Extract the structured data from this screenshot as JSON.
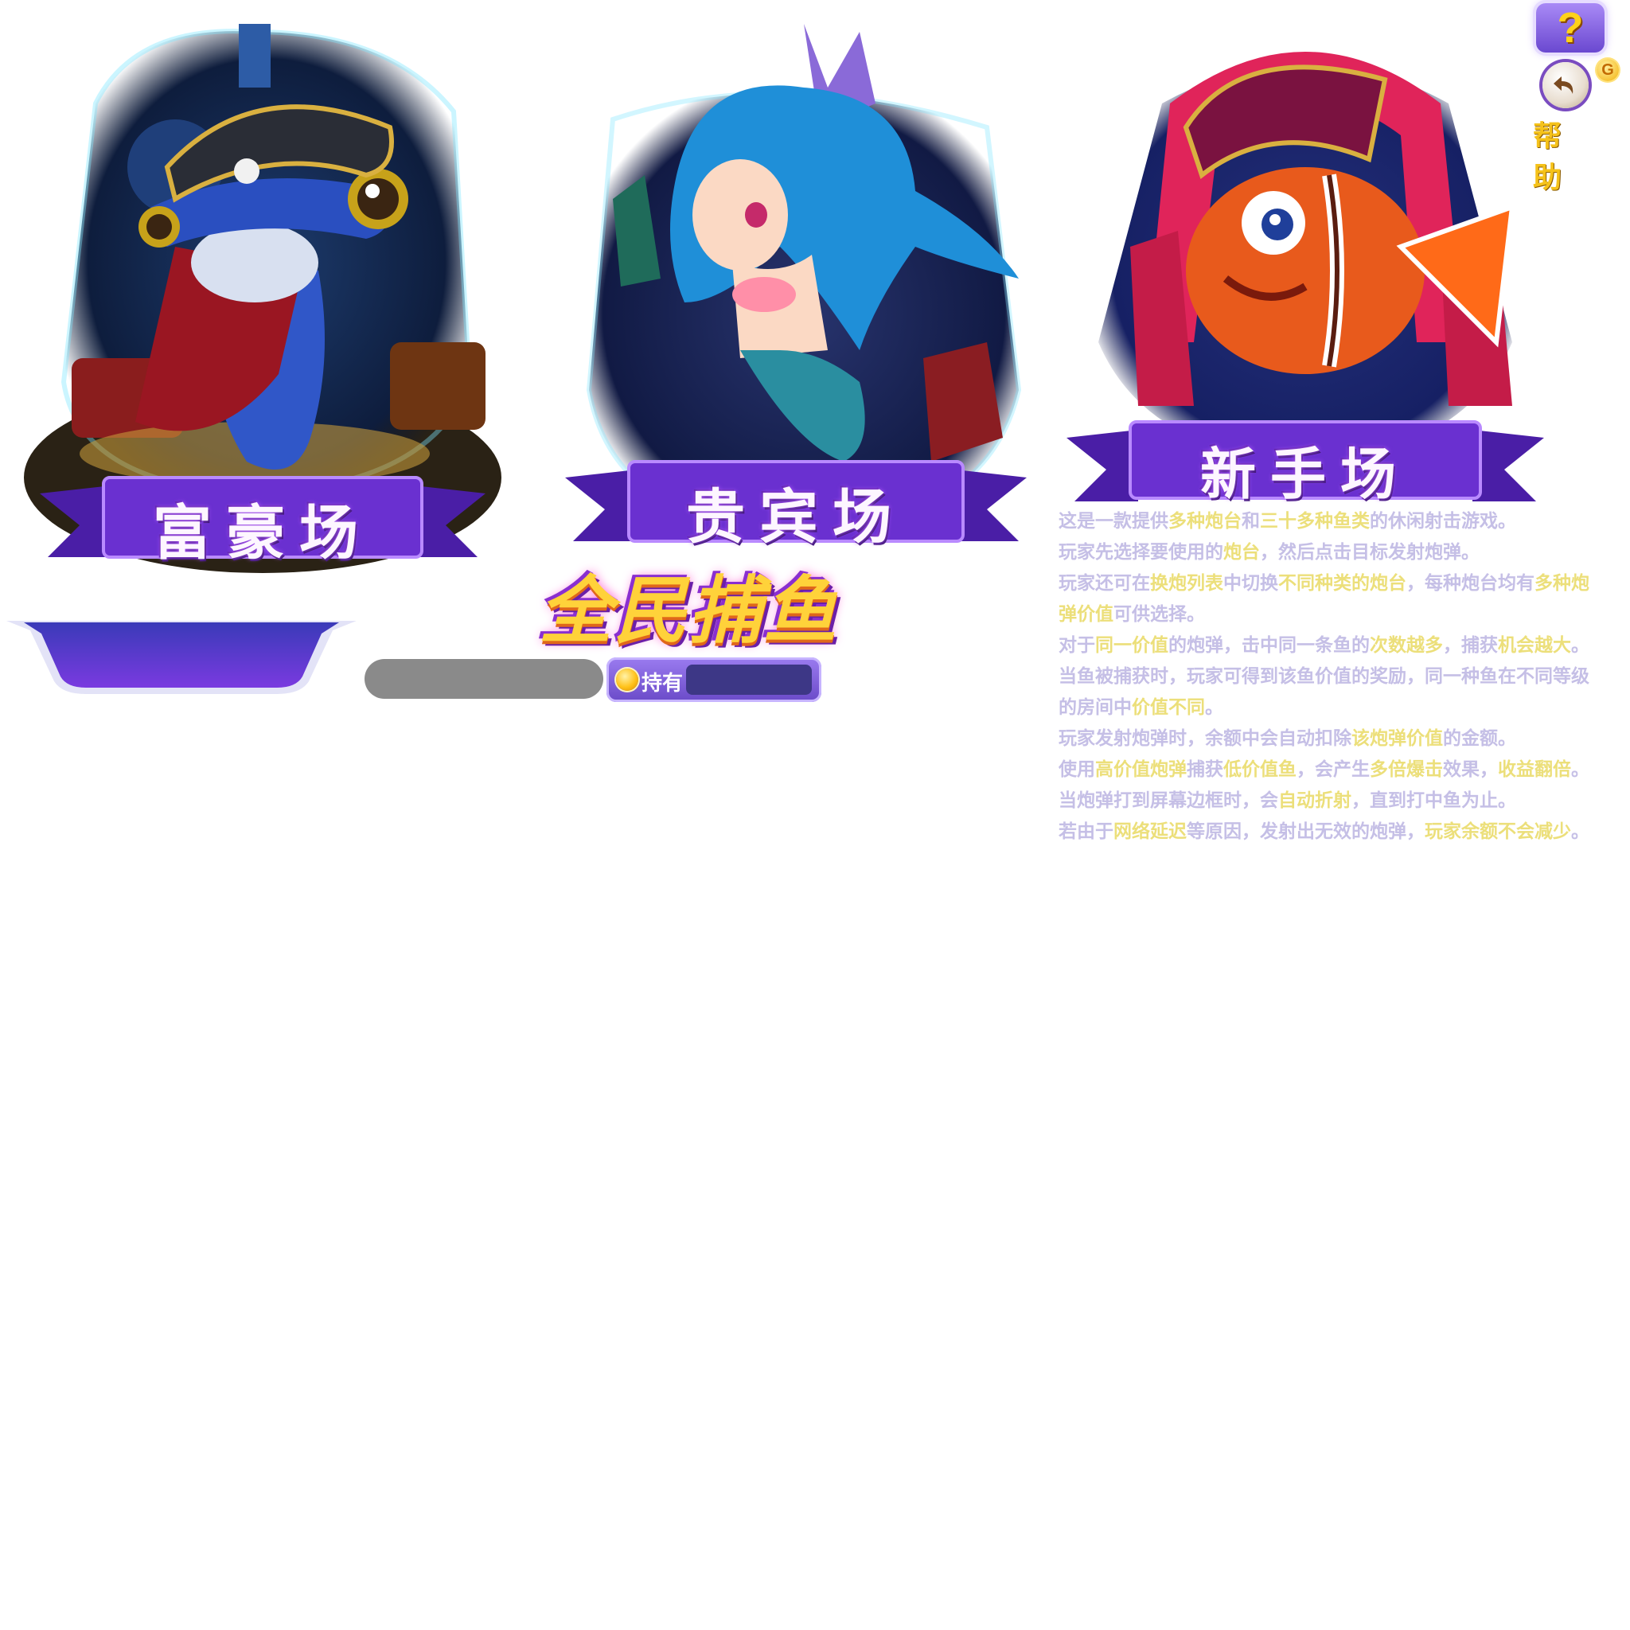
{
  "rooms": [
    {
      "id": "rich",
      "label": "富豪场",
      "character": "hammerhead-shark-pirate"
    },
    {
      "id": "vip",
      "label": "贵宾场",
      "character": "mermaid"
    },
    {
      "id": "novice",
      "label": "新手场",
      "character": "clownfish-pirate"
    }
  ],
  "logo": {
    "text": "全民捕鱼"
  },
  "holdings": {
    "label": "持有",
    "value": ""
  },
  "help": {
    "question_icon": "?",
    "badge": "G",
    "label": "帮助",
    "paragraphs": [
      [
        {
          "t": "这是一款提供",
          "h": false
        },
        {
          "t": "多种炮台",
          "h": true
        },
        {
          "t": "和",
          "h": false
        },
        {
          "t": "三十多种鱼类",
          "h": true
        },
        {
          "t": "的休闲射击游戏。",
          "h": false
        }
      ],
      [
        {
          "t": "玩家先选择要使用的",
          "h": false
        },
        {
          "t": "炮台",
          "h": true
        },
        {
          "t": "，然后点击目标发射炮弹。",
          "h": false
        }
      ],
      [
        {
          "t": "玩家还可在",
          "h": false
        },
        {
          "t": "换炮列表",
          "h": true
        },
        {
          "t": "中切换",
          "h": false
        },
        {
          "t": "不同种类的炮台",
          "h": true
        },
        {
          "t": "，每种炮台均有",
          "h": false
        },
        {
          "t": "多种炮弹价值",
          "h": true
        },
        {
          "t": "可供选择。",
          "h": false
        }
      ],
      [
        {
          "t": "对于",
          "h": false
        },
        {
          "t": "同一价值",
          "h": true
        },
        {
          "t": "的炮弹，击中同一条鱼的",
          "h": false
        },
        {
          "t": "次数越多",
          "h": true
        },
        {
          "t": "，捕获",
          "h": false
        },
        {
          "t": "机会越大",
          "h": true
        },
        {
          "t": "。",
          "h": false
        }
      ],
      [
        {
          "t": "当鱼被捕获时，玩家可得到该鱼价值的奖励，同一种鱼在不同等级的房间中",
          "h": false
        },
        {
          "t": "价值不同",
          "h": true
        },
        {
          "t": "。",
          "h": false
        }
      ],
      [
        {
          "t": "玩家发射炮弹时，余额中会自动扣除",
          "h": false
        },
        {
          "t": "该炮弹价值",
          "h": true
        },
        {
          "t": "的金额。",
          "h": false
        }
      ],
      [
        {
          "t": "使用",
          "h": false
        },
        {
          "t": "高价值炮弹",
          "h": true
        },
        {
          "t": "捕获",
          "h": false
        },
        {
          "t": "低价值鱼",
          "h": true
        },
        {
          "t": "，会产生",
          "h": false
        },
        {
          "t": "多倍爆击",
          "h": true
        },
        {
          "t": "效果，",
          "h": false
        },
        {
          "t": "收益翻倍",
          "h": true
        },
        {
          "t": "。",
          "h": false
        }
      ],
      [
        {
          "t": "当炮弹打到屏幕边框时，会",
          "h": false
        },
        {
          "t": "自动折射",
          "h": true
        },
        {
          "t": "，直到打中鱼为止。",
          "h": false
        }
      ],
      [
        {
          "t": "若由于",
          "h": false
        },
        {
          "t": "网络延迟",
          "h": true
        },
        {
          "t": "等原因，发射出无效的炮弹，",
          "h": false
        },
        {
          "t": "玩家余额不会减少",
          "h": true
        },
        {
          "t": "。",
          "h": false
        }
      ]
    ]
  },
  "colors": {
    "text": "#c5bfe6",
    "highlight": "#ecdf7a",
    "banner": "#6a2fc8",
    "panel": "#7b3fe0"
  }
}
